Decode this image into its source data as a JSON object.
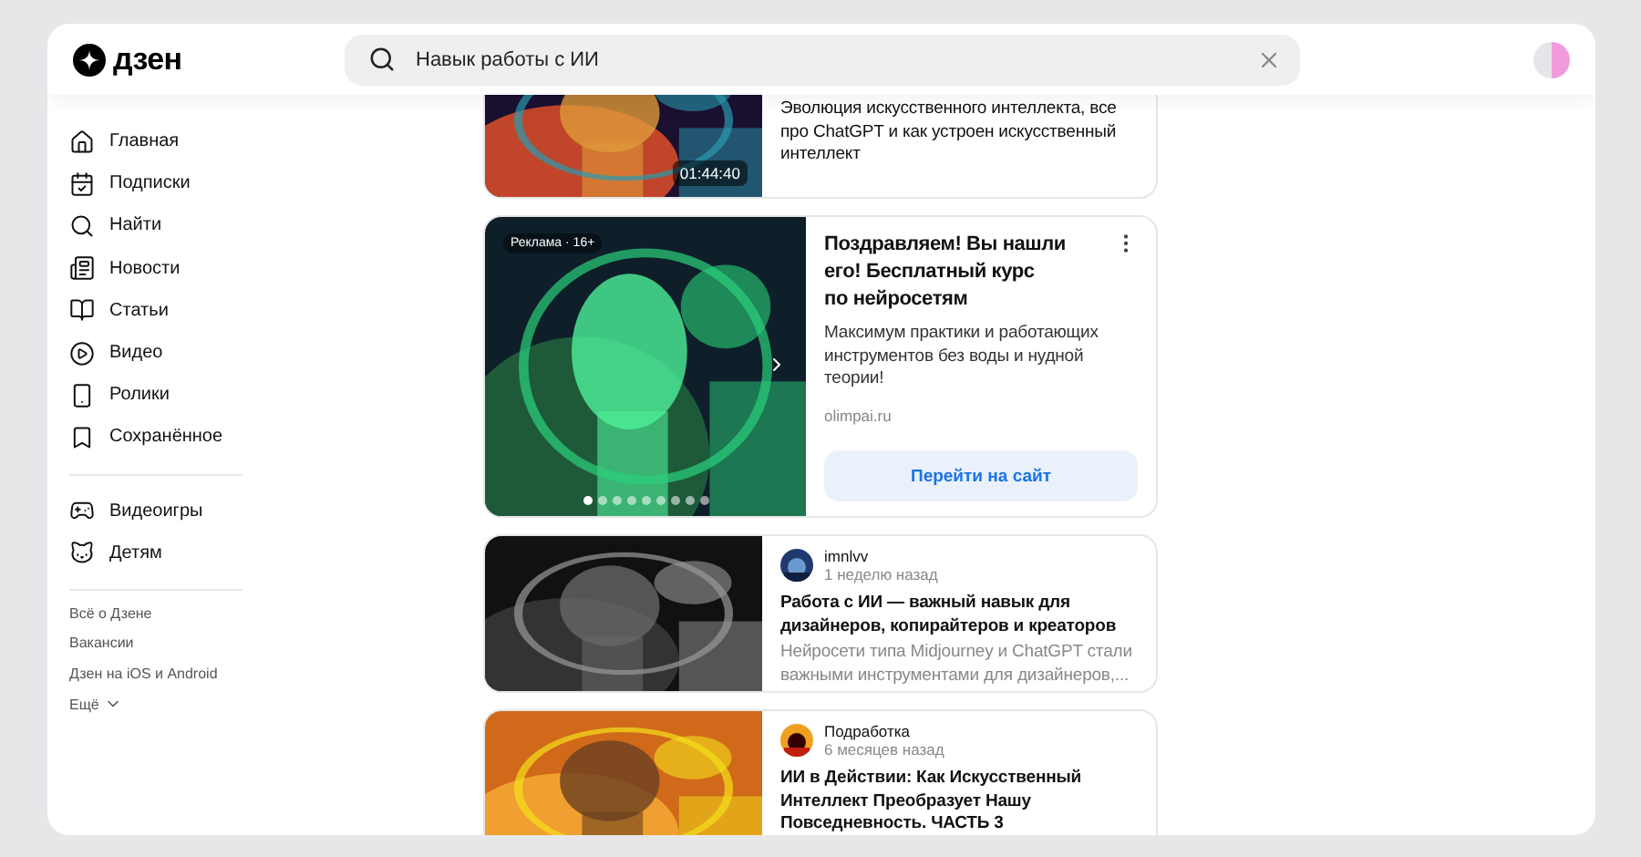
{
  "header": {
    "logo": "дзен",
    "search": {
      "value": "Навык работы с ИИ"
    }
  },
  "sidebar": {
    "groups": [
      [
        "Главная",
        "Подписки",
        "Найти",
        "Новости",
        "Статьи",
        "Видео",
        "Ролики",
        "Сохранённое"
      ],
      [
        "Видеоигры",
        "Детям"
      ]
    ],
    "links": [
      "Всё о Дзене",
      "Вакансии",
      "Дзен на iOS и Android"
    ],
    "more": "Ещё"
  },
  "feed": [
    {
      "kind": "video",
      "duration": "01:44:40",
      "title": "Эволюция искусственного интеллекта, все про ChatGPT и как устроен искусственный интеллект"
    },
    {
      "kind": "ad",
      "badge": "Реклама · 16+",
      "title": "Поздравляем! Вы нашли его! Бесплатный курс\nпо нейросетям",
      "text": "Максимум практики и работающих инструментов без воды и нудной теории!",
      "domain": "olimpai.ru",
      "button": "Перейти на сайт",
      "slides": [
        {
          "selected": true
        },
        {
          "selected": false
        },
        {
          "selected": false
        },
        {
          "selected": false
        },
        {
          "selected": false
        },
        {
          "selected": false
        },
        {
          "selected": false
        },
        {
          "selected": false
        },
        {
          "selected": false
        }
      ]
    },
    {
      "kind": "article",
      "author": "imnlvv",
      "time": "1 неделю назад",
      "title": "Работа с ИИ — важный навык для дизайнеров, копирайтеров и креаторов",
      "text": "Нейросети типа Midjourney и ChatGPT стали важными инструментами для дизайнеров,..."
    },
    {
      "kind": "article",
      "author": "Подработка",
      "time": "6 месяцев назад",
      "title": "ИИ в Действии: Как Искусственный Интеллект Преобразует Нашу Повседневность. ЧАСТЬ 3"
    }
  ]
}
